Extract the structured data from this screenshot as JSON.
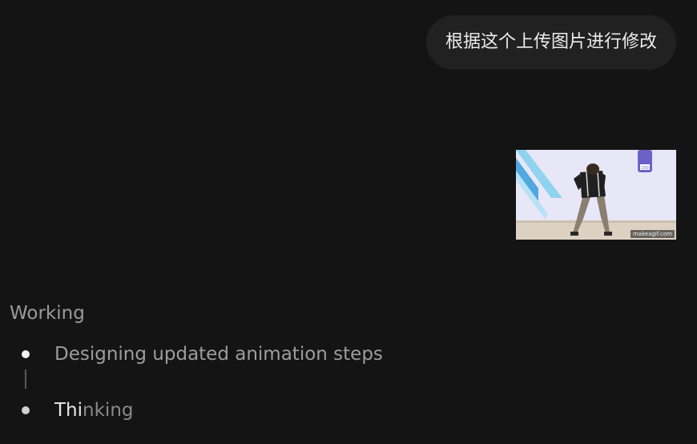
{
  "chat": {
    "user_message": "根据这个上传图片进行修改"
  },
  "attachment": {
    "watermark": "makeagif.com",
    "wall_badge": "100"
  },
  "working": {
    "title": "Working",
    "steps": [
      {
        "label": "Designing updated animation steps",
        "state": "active"
      },
      {
        "label_highlight": "Thi",
        "label_rest": "nking",
        "state": "in-progress"
      }
    ]
  },
  "colors": {
    "background": "#141414",
    "bubble": "#212121",
    "text_muted": "#9d9d9d",
    "text_bright": "#ececec"
  }
}
